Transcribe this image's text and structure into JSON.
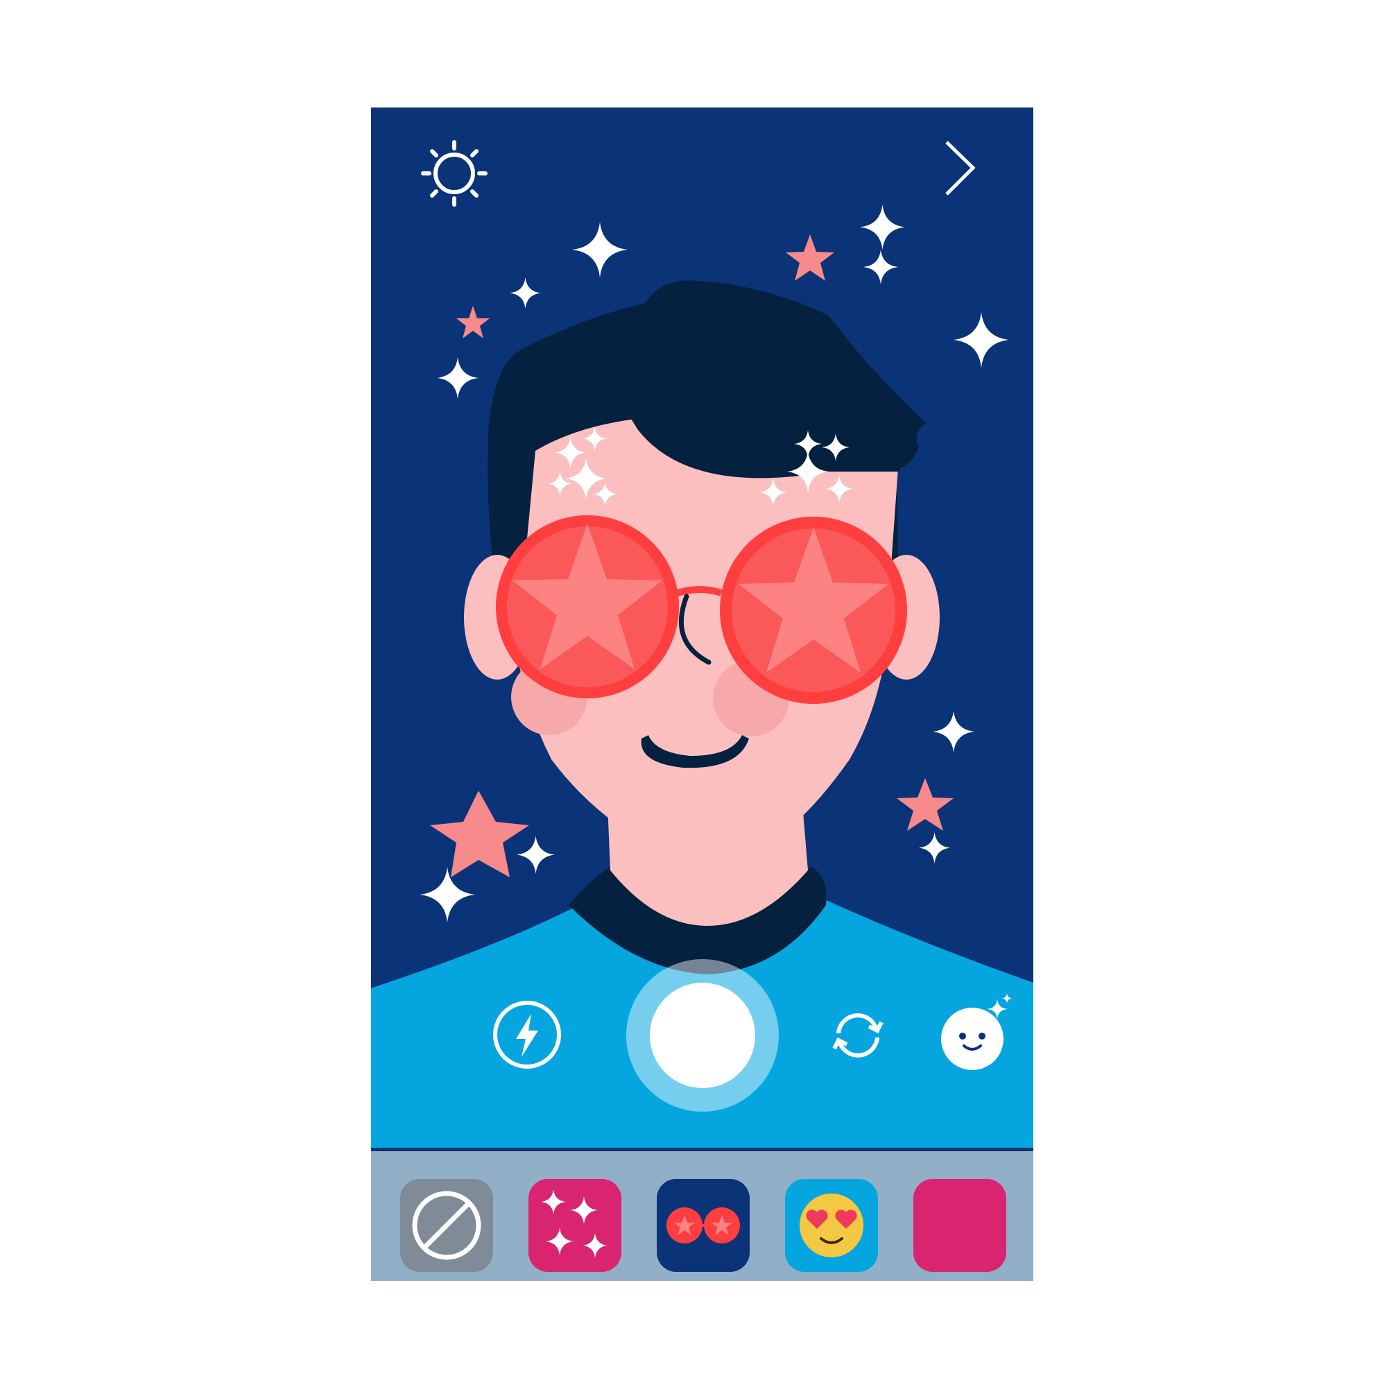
{
  "app": {
    "screen": "camera-face-filter"
  },
  "top_bar": {
    "left_icon": "brightness-icon",
    "right_icon": "chevron-right-icon"
  },
  "controls": {
    "flash_icon": "flash-icon",
    "shutter": "shutter-button",
    "switch_camera_icon": "switch-camera-icon",
    "effects_icon": "face-effects-icon"
  },
  "filters": [
    {
      "name": "none",
      "icon": "no-filter-icon",
      "color": "#7f8c97"
    },
    {
      "name": "sparkles",
      "icon": "sparkles-icon",
      "color": "#d9246f"
    },
    {
      "name": "star-glasses",
      "icon": "star-glasses-icon",
      "color": "#0a3378"
    },
    {
      "name": "heart-eyes",
      "icon": "heart-eyes-emoji-icon",
      "color": "#05a6e0"
    },
    {
      "name": "pink",
      "icon": "color-swatch",
      "color": "#d9246f"
    }
  ],
  "colors": {
    "background": "#0a3378",
    "shirt": "#05a6e0",
    "filter_bar": "#92afc8",
    "skin": "#fcbfc0",
    "glasses": "#ff3f3f",
    "hair": "#04213f"
  }
}
